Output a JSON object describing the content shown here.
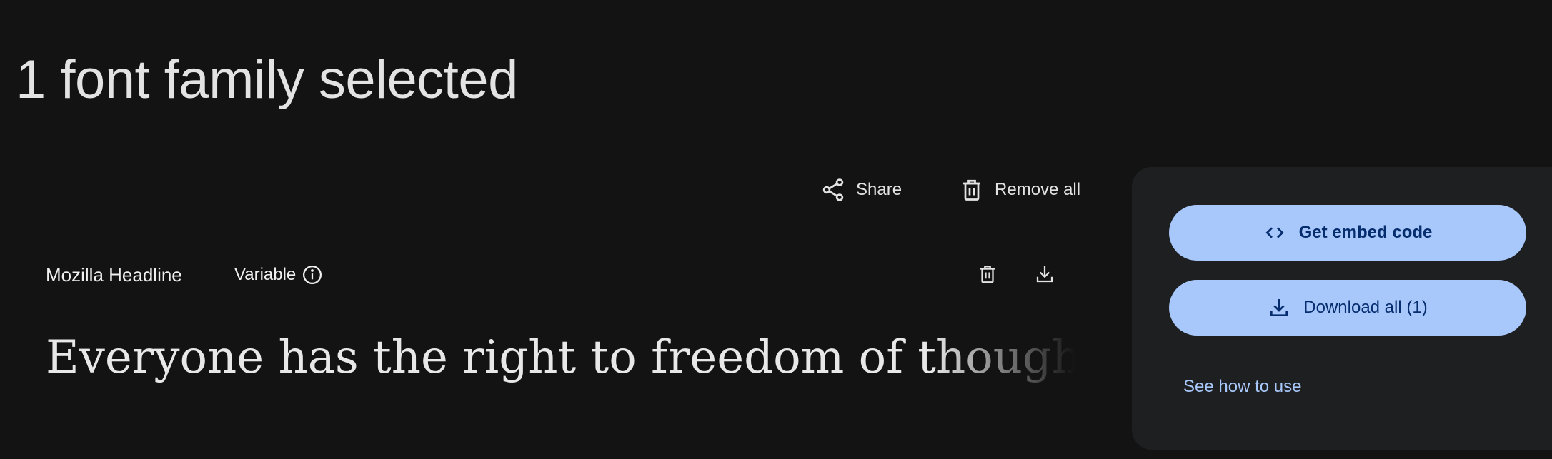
{
  "heading": "1 font family selected",
  "toolbar": {
    "share_label": "Share",
    "remove_all_label": "Remove all"
  },
  "family": {
    "name": "Mozilla Headline",
    "variable_label": "Variable",
    "sample_text": "Everyone has the right to freedom of thought, c"
  },
  "panel": {
    "embed_label": "Get embed code",
    "download_label": "Download all (1)",
    "see_how_label": "See how to use"
  },
  "icons": {
    "share": "share-icon",
    "remove_all": "trash-icon",
    "info": "info-icon",
    "delete_family": "trash-icon",
    "download_family": "download-icon",
    "embed": "code-icon",
    "download_all": "download-icon"
  },
  "colors": {
    "background": "#131313",
    "panel": "#1e1f20",
    "pill": "#a8c7fa",
    "pill_text": "#062e6f",
    "link": "#a8c7fa",
    "text": "#e3e3e3"
  }
}
